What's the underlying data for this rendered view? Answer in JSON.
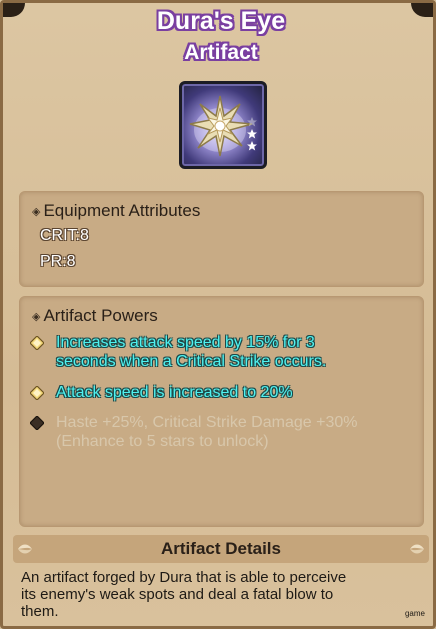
{
  "artifact": {
    "name": "Dura's Eye",
    "category": "Artifact",
    "icon": "crown-star-artifact-icon",
    "stars_filled": 2
  },
  "equipment_attributes": {
    "heading": "Equipment Attributes",
    "items": [
      "CRIT:8",
      "PR:8"
    ]
  },
  "artifact_powers": {
    "heading": "Artifact Powers",
    "powers": [
      {
        "line1": "Increases attack speed by 15% for 3",
        "line2": "seconds when a Critical Strike occurs.",
        "unlocked": true
      },
      {
        "line1": "Attack speed is increased to 20%",
        "line2": "",
        "unlocked": true
      },
      {
        "line1": "Haste +25%, Critical Strike Damage +30%",
        "line2": "(Enhance to 5 stars to unlock)",
        "unlocked": false
      }
    ]
  },
  "artifact_details": {
    "heading": "Artifact Details",
    "line1": "An artifact forged by Dura that is able to perceive",
    "line2": "its enemy's weak spots and deal a fatal blow to",
    "line3": "them."
  },
  "watermark": "game",
  "colors": {
    "title_outline": "#7a3fa0",
    "power_unlocked": "#4ff2f0",
    "power_locked": "#d8c7ab",
    "panel_bg": "#d7bf99"
  }
}
